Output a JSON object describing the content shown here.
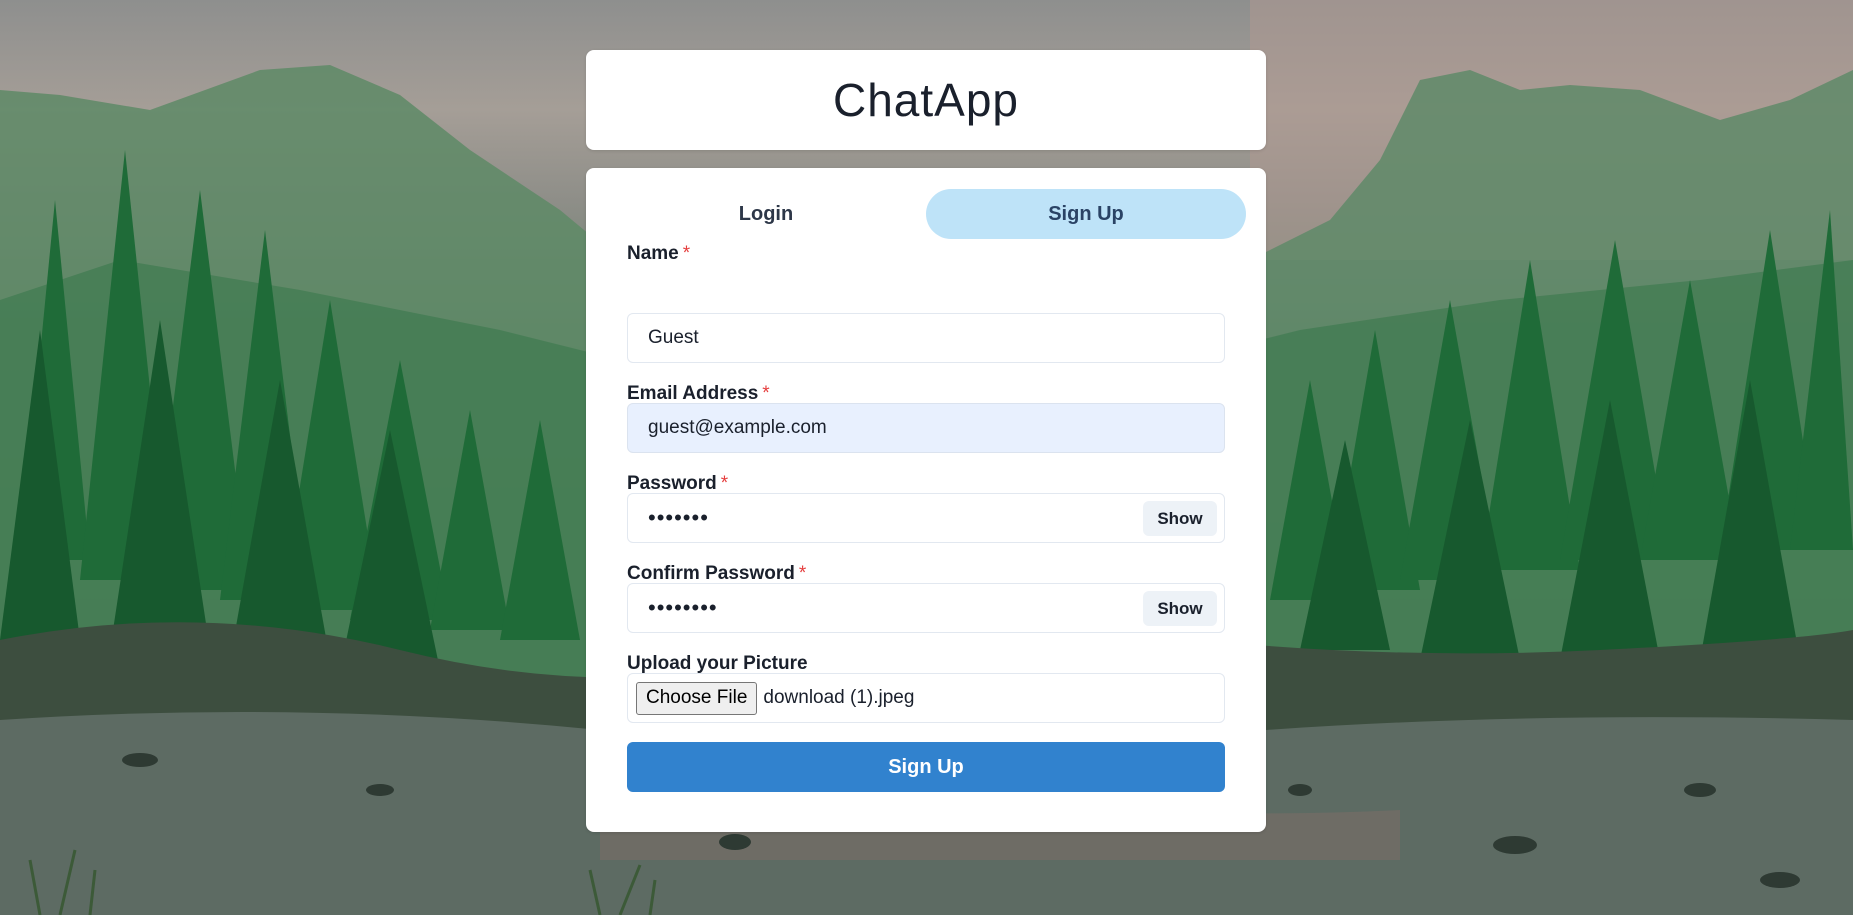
{
  "app": {
    "title": "ChatApp"
  },
  "tabs": [
    {
      "label": "Login",
      "active": false
    },
    {
      "label": "Sign Up",
      "active": true
    }
  ],
  "form": {
    "name": {
      "label": "Name",
      "required_mark": "*",
      "value": "Guest"
    },
    "email": {
      "label": "Email Address",
      "required_mark": "*",
      "value": "guest@example.com"
    },
    "password": {
      "label": "Password",
      "required_mark": "*",
      "value_masked": "•••••••",
      "toggle_label": "Show"
    },
    "confirm_password": {
      "label": "Confirm Password",
      "required_mark": "*",
      "value_masked": "••••••••",
      "toggle_label": "Show"
    },
    "picture": {
      "label": "Upload your Picture",
      "button_label": "Choose File",
      "file_name": "download (1).jpeg"
    },
    "submit_label": "Sign Up"
  },
  "colors": {
    "accent": "#3182ce",
    "active_tab": "#bee3f8",
    "required": "#e53e3e",
    "autofill_bg": "#e8f0fe"
  }
}
